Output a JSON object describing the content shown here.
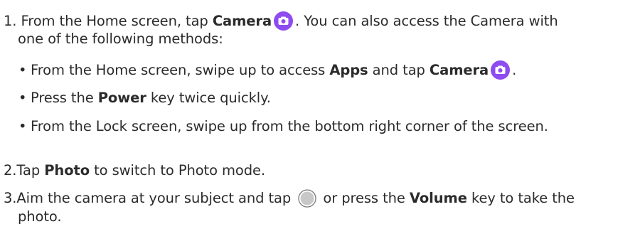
{
  "steps": {
    "s1": {
      "number": "1.",
      "text_before": "From the Home screen, tap ",
      "bold": "Camera",
      "text_after": ". You can also access the Camera with",
      "continuation": "one of the following methods:",
      "icon": "camera-app-icon"
    },
    "sub": [
      {
        "bullet": "•",
        "text_a": "From the Home screen, swipe up to access ",
        "bold_a": "Apps",
        "text_b": " and tap ",
        "bold_b": "Camera",
        "text_c": ".",
        "icon": "camera-app-icon"
      },
      {
        "bullet": "•",
        "text_a": "Press the ",
        "bold_a": "Power",
        "text_b": " key twice quickly."
      },
      {
        "bullet": "•",
        "text_a": "From the Lock screen, swipe up from the bottom right corner of the screen."
      }
    ],
    "s2": {
      "number": "2.",
      "text_before": "Tap ",
      "bold": "Photo",
      "text_after": " to switch to Photo mode."
    },
    "s3": {
      "number": "3.",
      "text_before": "Aim the camera at your subject and tap ",
      "text_mid": " or press the ",
      "bold": "Volume",
      "text_after": " key to take the",
      "continuation": "photo.",
      "icon": "shutter-button-icon"
    }
  },
  "colors": {
    "text": "#2b2b2b",
    "camera_icon": "#8e4bf0",
    "shutter_fill": "#c8c8c8",
    "shutter_ring": "#7a7a7a"
  }
}
